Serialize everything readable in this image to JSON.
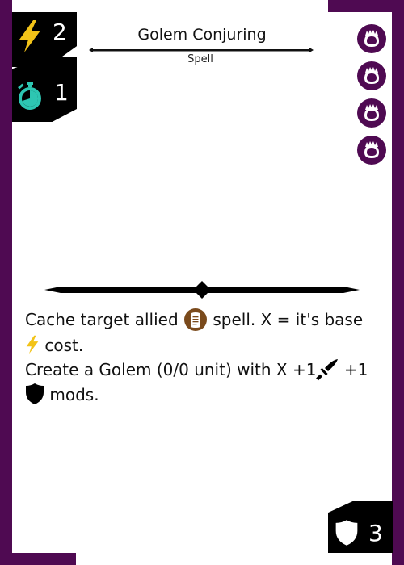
{
  "colors": {
    "frame": "#4f0a52",
    "badge": "#4f0a52",
    "stat_bg": "#000000",
    "energy": "#f2c318",
    "timer": "#2dc6b2",
    "spell_icon": "#7a4a1c"
  },
  "card": {
    "title": "Golem Conjuring",
    "type": "Spell"
  },
  "stats": {
    "cost": {
      "icon": "lightning-icon",
      "value": "2"
    },
    "speed": {
      "icon": "stopwatch-icon",
      "value": "1"
    },
    "armor": {
      "icon": "shield-icon",
      "value": "3"
    }
  },
  "rune_badges": [
    "rune-icon",
    "rune-icon",
    "rune-icon",
    "rune-icon"
  ],
  "rules": {
    "line1_a": "Cache target allied",
    "line1_b": "spell. X = it's base",
    "line2_b": "cost.",
    "line3_a": "Create a Golem (0/0 unit) with X +1",
    "line3_b": "+1",
    "line4_b": "mods.",
    "icons": {
      "spell": "spell-scroll-icon",
      "energy": "lightning-icon",
      "attack": "sword-icon",
      "defense": "shield-icon"
    }
  }
}
